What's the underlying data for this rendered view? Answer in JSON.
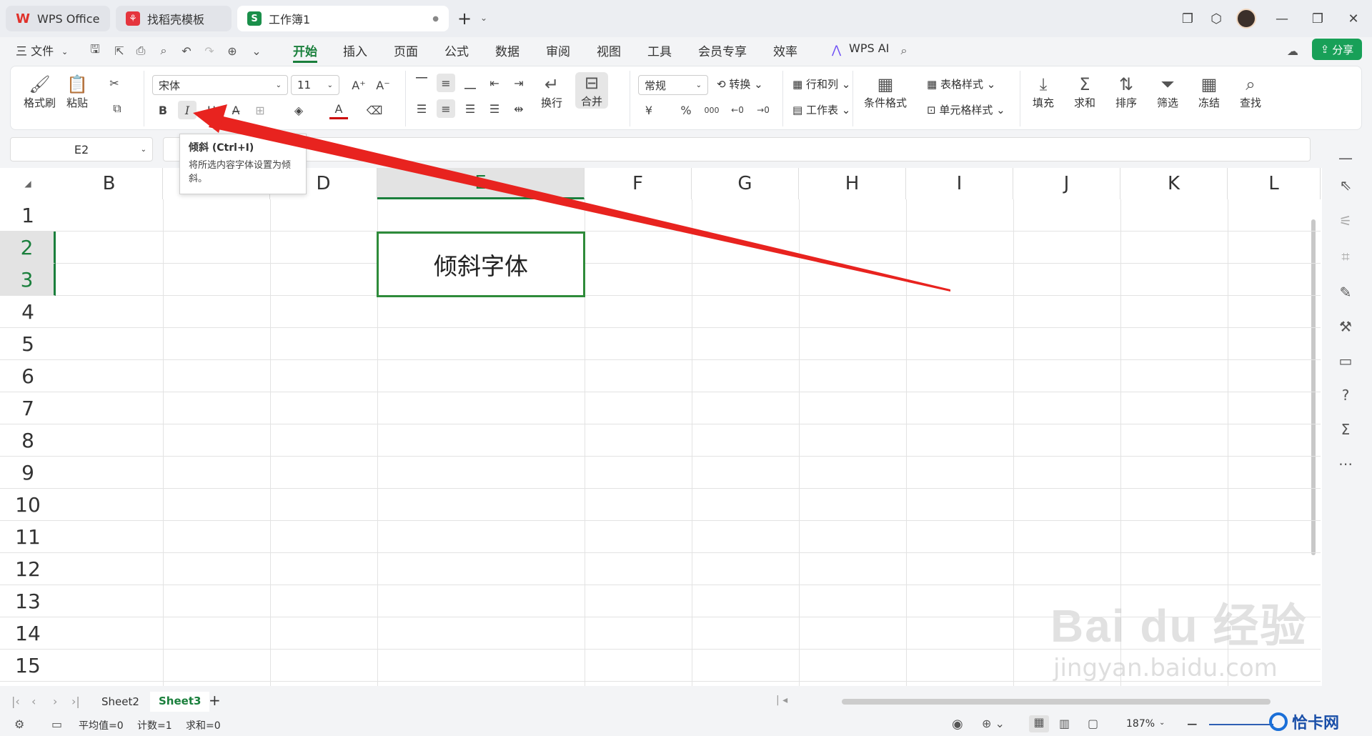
{
  "tabs": [
    {
      "label": "WPS Office",
      "logo": "W",
      "logo_color": "#e0322b"
    },
    {
      "label": "找稻壳模板",
      "logo": "⚘",
      "logo_color": "#e5353d"
    },
    {
      "label": "工作簿1",
      "logo": "S",
      "logo_color": "#1a8f4a",
      "dot": "●"
    }
  ],
  "new_tab": "+",
  "file_menu": "三 文件",
  "menus": [
    "开始",
    "插入",
    "页面",
    "公式",
    "数据",
    "审阅",
    "视图",
    "工具",
    "会员专享",
    "效率"
  ],
  "wps_ai": "WPS AI",
  "share": "分享",
  "ribbon": {
    "format_painter": "格式刷",
    "paste": "粘贴",
    "font_name": "宋体",
    "font_size": "11",
    "wrap": "换行",
    "merge": "合并",
    "number_format": "常规",
    "convert": "转换",
    "rows_cols": "行和列",
    "worksheet": "工作表",
    "cond_format": "条件格式",
    "table_style": "表格样式",
    "cell_style": "单元格样式",
    "fill": "填充",
    "sum": "求和",
    "sort": "排序",
    "filter": "筛选",
    "freeze": "冻结",
    "find": "查找",
    "bold": "B",
    "italic": "I",
    "underline": "U",
    "currency": "¥",
    "percent": "%",
    "thousands": "000"
  },
  "name_box": "E2",
  "tooltip": {
    "title": "倾斜 (Ctrl+I)",
    "desc": "将所选内容字体设置为倾斜。"
  },
  "columns": [
    "B",
    "",
    "D",
    "E",
    "F",
    "G",
    "H",
    "I",
    "J",
    "K",
    "L"
  ],
  "rows": [
    "1",
    "2",
    "3",
    "4",
    "5",
    "6",
    "7",
    "8",
    "9",
    "10",
    "11",
    "12",
    "13",
    "14",
    "15"
  ],
  "cell_text": "倾斜字体",
  "sheets": [
    "Sheet2",
    "Sheet3"
  ],
  "active_sheet": "Sheet3",
  "status": {
    "avg": "平均值=0",
    "count": "计数=1",
    "sum": "求和=0",
    "zoom": "187%"
  },
  "watermark": {
    "brand": "Bai du 经验",
    "url": "jingyan.baidu.com",
    "corner": "恰卡网"
  },
  "colors": {
    "accent": "#1a7f3c",
    "arrow": "#e8231f",
    "share": "#18a058"
  }
}
